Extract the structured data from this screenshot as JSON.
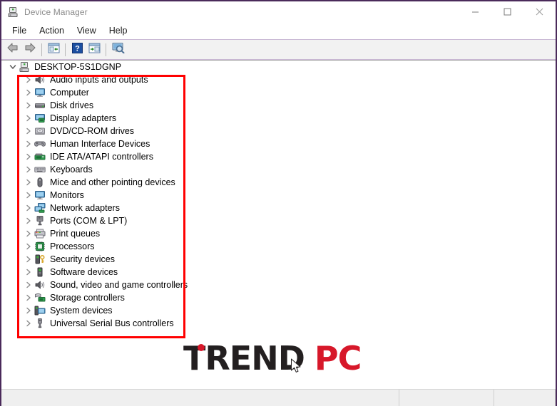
{
  "window": {
    "title": "Device Manager",
    "title_icon": "device-manager-icon",
    "border_color": "#4a2a5a",
    "caption": {
      "minimize": "—",
      "maximize": "☐",
      "close": "✕"
    }
  },
  "menubar": {
    "items": [
      {
        "label": "File"
      },
      {
        "label": "Action"
      },
      {
        "label": "View"
      },
      {
        "label": "Help"
      }
    ]
  },
  "toolbar": {
    "buttons": [
      {
        "name": "back-arrow-icon",
        "tooltip": "Back"
      },
      {
        "name": "forward-arrow-icon",
        "tooltip": "Forward"
      },
      {
        "name": "separator"
      },
      {
        "name": "properties-icon",
        "tooltip": "Properties"
      },
      {
        "name": "separator"
      },
      {
        "name": "help-icon",
        "tooltip": "Help"
      },
      {
        "name": "update-driver-icon",
        "tooltip": "Update Driver Software"
      },
      {
        "name": "separator"
      },
      {
        "name": "scan-hardware-icon",
        "tooltip": "Scan for hardware changes"
      }
    ]
  },
  "tree": {
    "root": {
      "label": "DESKTOP-5S1DGNP",
      "expanded": true,
      "icon": "computer-icon",
      "twisty": "⌄"
    },
    "twisty_collapsed": "›",
    "items": [
      {
        "label": "Audio inputs and outputs",
        "icon": "speaker-icon"
      },
      {
        "label": "Computer",
        "icon": "monitor-icon"
      },
      {
        "label": "Disk drives",
        "icon": "harddisk-icon"
      },
      {
        "label": "Display adapters",
        "icon": "display-adapter-icon"
      },
      {
        "label": "DVD/CD-ROM drives",
        "icon": "optical-drive-icon"
      },
      {
        "label": "Human Interface Devices",
        "icon": "gamepad-icon"
      },
      {
        "label": "IDE ATA/ATAPI controllers",
        "icon": "ide-controller-icon"
      },
      {
        "label": "Keyboards",
        "icon": "keyboard-icon"
      },
      {
        "label": "Mice and other pointing devices",
        "icon": "mouse-icon"
      },
      {
        "label": "Monitors",
        "icon": "monitor-icon"
      },
      {
        "label": "Network adapters",
        "icon": "network-adapter-icon"
      },
      {
        "label": "Ports (COM & LPT)",
        "icon": "port-icon"
      },
      {
        "label": "Print queues",
        "icon": "printer-icon"
      },
      {
        "label": "Processors",
        "icon": "processor-icon"
      },
      {
        "label": "Security devices",
        "icon": "security-device-icon"
      },
      {
        "label": "Software devices",
        "icon": "software-device-icon"
      },
      {
        "label": "Sound, video and game controllers",
        "icon": "speaker-icon"
      },
      {
        "label": "Storage controllers",
        "icon": "storage-controller-icon"
      },
      {
        "label": "System devices",
        "icon": "system-device-icon"
      },
      {
        "label": "Universal Serial Bus controllers",
        "icon": "usb-icon"
      }
    ]
  },
  "annotation": {
    "highlight_color": "#ff0000"
  },
  "watermark": {
    "text_dark": "TREND",
    "text_red": "PC",
    "dark_color": "#231f20",
    "red_color": "#d7182a",
    "cursor_icon": "mouse-pointer-icon"
  },
  "statusbar": {
    "panes": [
      "",
      "",
      ""
    ]
  }
}
